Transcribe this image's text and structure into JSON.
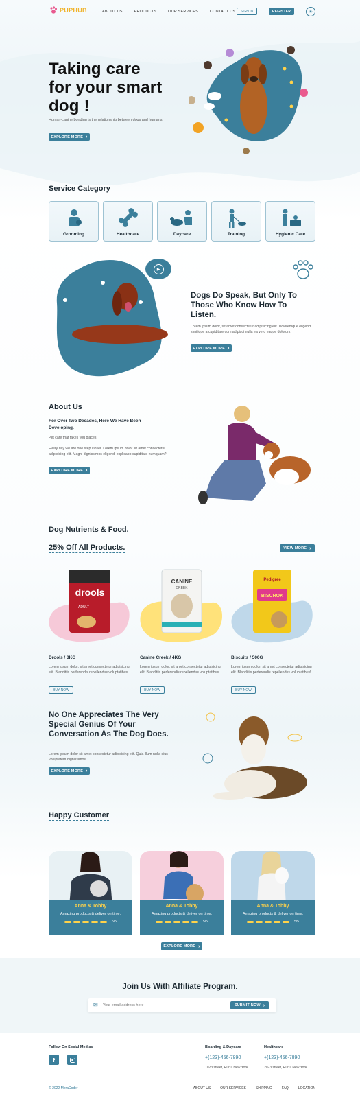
{
  "brand": {
    "name": "PUPHUB"
  },
  "nav": {
    "items": [
      "ABOUT US",
      "PRODUCTS",
      "OUR SERVICES",
      "CONTACT US"
    ],
    "sign_in": "SIGN IN",
    "register": "REGISTER"
  },
  "hero": {
    "title_line1": "Taking care",
    "title_line2": "for your smart",
    "title_line3": "dog !",
    "subtitle": "Human-canine bonding is the relationship between dogs and humans.",
    "cta": "EXPLORE MORE"
  },
  "services": {
    "heading": "Service Category",
    "items": [
      "Grooming",
      "Healthcare",
      "Daycare",
      "Training",
      "Hygienic Care"
    ]
  },
  "speak": {
    "title": "Dogs Do Speak, But Only To Those Who Know How To Listen.",
    "text": "Lorem ipsum dolor, sit amet consectetur adipisicing elit. Doloremque eligendi similique a cupiditate cum adipisci nulla ea vero eaque dolorum.",
    "cta": "EXPLORE MORE"
  },
  "about": {
    "heading": "About Us",
    "subheading": "For Over Two Decades, Here We Have Been Developing.",
    "tagline": "Pet care that takes you places",
    "text": "Every day we are one step closer. Lorem ipsum dolor sit amet consectetur adipisicing elit. Magni dignissimos eligendi explicabo cupiditate numquam?",
    "cta": "EXPLORE MORE"
  },
  "products": {
    "heading": "Dog Nutrients & Food.",
    "offer": "25% Off All Products.",
    "view_more": "VIEW MORE",
    "items": [
      {
        "name": "Drools / 3KG",
        "brand_text": "drools",
        "pack_text": "ADULT",
        "desc": "Lorem ipsum dolor, sit amet consectetur adipisicing elit. Blanditiis perferendis repellendus voluptatibus!",
        "cta": "BUY NOW"
      },
      {
        "name": "Canine Creek / 4KG",
        "brand_text": "CANINE",
        "pack_text": "CREEK",
        "desc": "Lorem ipsum dolor, sit amet consectetur adipisicing elit. Blanditiis perferendis repellendus voluptatibus!",
        "cta": "BUY NOW"
      },
      {
        "name": "Biscuits / 500G",
        "brand_text": "Pedigree",
        "pack_text": "BISCROK",
        "desc": "Lorem ipsum dolor, sit amet consectetur adipisicing elit. Blanditiis perferendis repellendus voluptatibus!",
        "cta": "BUY NOW"
      }
    ]
  },
  "quote": {
    "title": "No One Appreciates The Very Special Genius Of Your Conversation As The Dog Does.",
    "text": "Lorem ipsum dolor sit amet consectetur adipisicing elit. Quia illum nulla eius voluptatem dignissimos.",
    "cta": "EXPLORE MORE"
  },
  "customers": {
    "heading": "Happy Customer",
    "cards": [
      {
        "name": "Anna & Tobby",
        "text": "Amazing products & deliver on time.",
        "rating": "5/5",
        "bg": "#e8f1f4"
      },
      {
        "name": "Anna & Tobby",
        "text": "Amazing products & deliver on time.",
        "rating": "5/5",
        "bg": "#f6cfdc"
      },
      {
        "name": "Anna & Tobby",
        "text": "Amazing products & deliver on time.",
        "rating": "5/5",
        "bg": "#bfd8ea"
      }
    ],
    "cta": "EXPLORE MORE"
  },
  "affiliate": {
    "title": "Join Us With Affiliate Program.",
    "placeholder": "Your email address here",
    "submit": "SUBMIT NOW"
  },
  "footer": {
    "social_heading": "Follow On Social Medias",
    "col1_heading": "Boarding & Daycare",
    "col1_phone": "+(123)-456-7890",
    "col1_address": "1023 street, Ruru, New York",
    "col2_heading": "Healthcare",
    "col2_phone": "+(123)-456-7890",
    "col2_address": "2023 street, Ruru, New York",
    "copyright": "© 2022 MeraCoder",
    "links": [
      "ABOUT US",
      "OUR SERVICES",
      "SHIPPING",
      "FAQ",
      "LOCATION"
    ]
  },
  "colors": {
    "accent": "#3b7f9b",
    "yellow": "#ffd24a",
    "pink": "#f6c9d8",
    "blue": "#bfd8ea"
  }
}
